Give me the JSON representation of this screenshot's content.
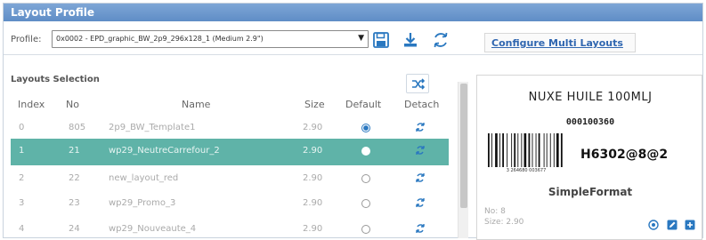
{
  "window": {
    "title": "Layout Profile"
  },
  "profile": {
    "label": "Profile:",
    "selected": "0x0002 - EPD_graphic_BW_2p9_296x128_1 (Medium 2.9\")"
  },
  "toolbar": {
    "save_icon": "floppy-disk-icon",
    "download_icon": "download-icon",
    "sync_icon": "sync-icon"
  },
  "configure_link": "Configure Multi Layouts",
  "layouts": {
    "title": "Layouts Selection",
    "columns": [
      "Index",
      "No",
      "Name",
      "Size",
      "Default",
      "Detach"
    ],
    "rows": [
      {
        "index": "0",
        "no": "805",
        "name": "2p9_BW_Template1",
        "size": "2.90",
        "default": true,
        "selected": false
      },
      {
        "index": "1",
        "no": "21",
        "name": "wp29_NeutreCarrefour_2",
        "size": "2.90",
        "default": false,
        "selected": true
      },
      {
        "index": "2",
        "no": "22",
        "name": "new_layout_red",
        "size": "2.90",
        "default": false,
        "selected": false
      },
      {
        "index": "3",
        "no": "23",
        "name": "wp29_Promo_3",
        "size": "2.90",
        "default": false,
        "selected": false
      },
      {
        "index": "4",
        "no": "24",
        "name": "wp29_Nouveaute_4",
        "size": "2.90",
        "default": false,
        "selected": false
      }
    ]
  },
  "preview": {
    "product_title": "NUXE HUILE 100MLJ",
    "code": "000100360",
    "barcode_number": "3 264680 003677",
    "code2": "H6302@8@2",
    "format_name": "SimpleFormat",
    "no_text": "No: 8",
    "size_text": "Size: 2.90"
  },
  "colors": {
    "accent": "#2a78c0",
    "selected_row": "#5fb3a8",
    "title_bar": "#6b97cc"
  }
}
